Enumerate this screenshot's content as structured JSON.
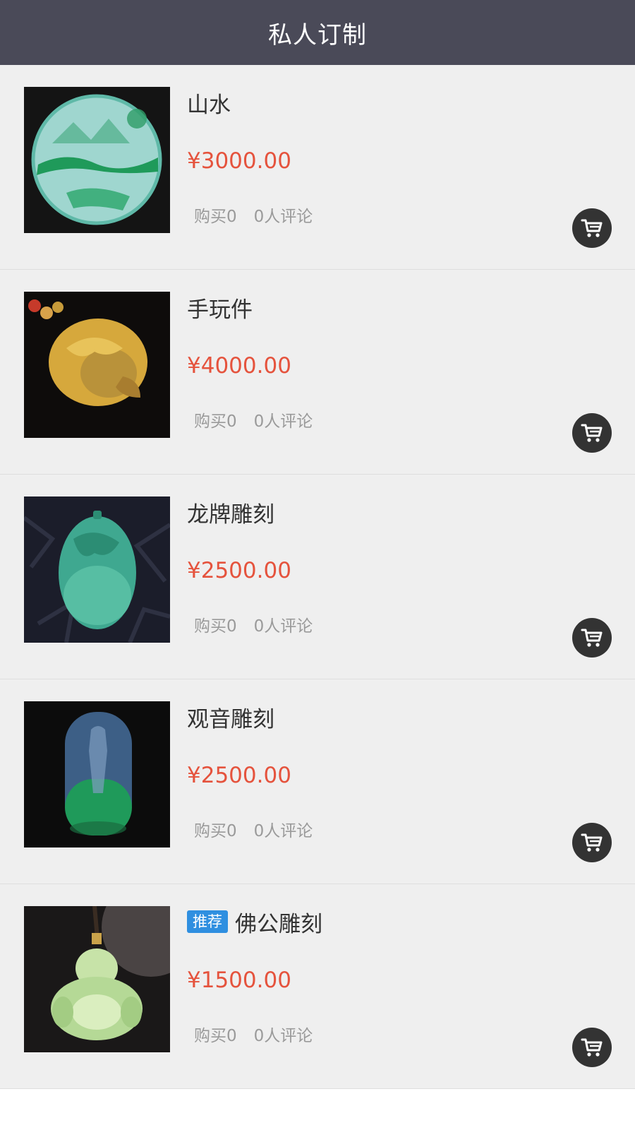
{
  "header": {
    "title": "私人订制"
  },
  "products": [
    {
      "name": "山水",
      "badge": "",
      "price": "¥3000.00",
      "sales": "购买0",
      "reviews": "0人评论",
      "image": "jade-landscape-disc"
    },
    {
      "name": "手玩件",
      "badge": "",
      "price": "¥4000.00",
      "sales": "购买0",
      "reviews": "0人评论",
      "image": "yellow-jade-carving"
    },
    {
      "name": "龙牌雕刻",
      "badge": "",
      "price": "¥2500.00",
      "sales": "购买0",
      "reviews": "0人评论",
      "image": "green-dragon-pendant"
    },
    {
      "name": "观音雕刻",
      "badge": "",
      "price": "¥2500.00",
      "sales": "购买0",
      "reviews": "0人评论",
      "image": "guanyin-pendant"
    },
    {
      "name": "佛公雕刻",
      "badge": "推荐",
      "price": "¥1500.00",
      "sales": "购买0",
      "reviews": "0人评论",
      "image": "buddha-pendant"
    }
  ],
  "colors": {
    "header_bg": "#4a4a58",
    "price": "#e5533d",
    "badge": "#2f8fe0",
    "cart_button": "#333333"
  },
  "icons": {
    "cart": "shopping-cart-icon"
  }
}
